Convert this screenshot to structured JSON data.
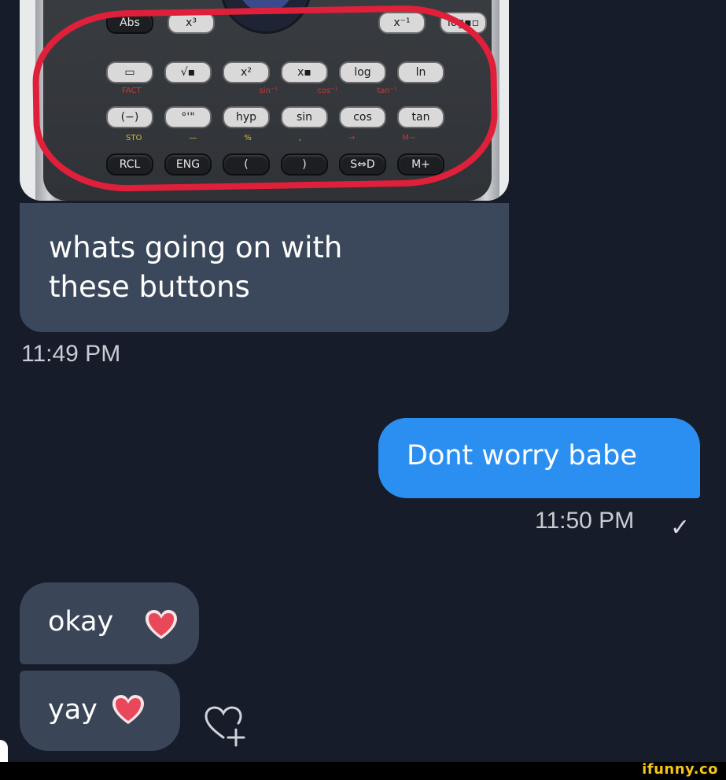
{
  "conversation": {
    "photo": {
      "keys_row1": [
        "Abs",
        "x³",
        "x⁻¹",
        "log▪▫"
      ],
      "keys_row2": [
        "▭",
        "√▪",
        "x²",
        "x▪",
        "log",
        "ln"
      ],
      "keys_row3": [
        "(−)",
        "°'\"",
        "hyp",
        "sin",
        "cos",
        "tan"
      ],
      "keys_row4": [
        "RCL",
        "ENG",
        "(",
        ")",
        "S⇔D",
        "M+"
      ],
      "shift_row1": [
        "FACT",
        "sin⁻¹",
        "cos⁻¹",
        "tan⁻¹"
      ],
      "shift_row2": [
        "STO",
        "—",
        "%",
        ",",
        "→",
        "M−"
      ]
    },
    "incoming_caption": "whats going on with these buttons",
    "incoming_caption_time": "11:49 PM",
    "outgoing_message": "Dont worry babe",
    "outgoing_message_time": "11:50 PM",
    "read_checkmark": "✓",
    "reply_1": "okay",
    "reply_2": "yay"
  },
  "watermark": "ifunny.co",
  "colors": {
    "background": "#161c29",
    "incoming_bubble": "#3b475a",
    "outgoing_bubble": "#2b8ff2",
    "highlight_ring": "#e0203a",
    "heart": "#e8485a",
    "watermark": "#f6c419"
  },
  "icons": {
    "reaction_heart": "heart-emoji-icon",
    "add_reaction": "heart-plus-icon"
  }
}
